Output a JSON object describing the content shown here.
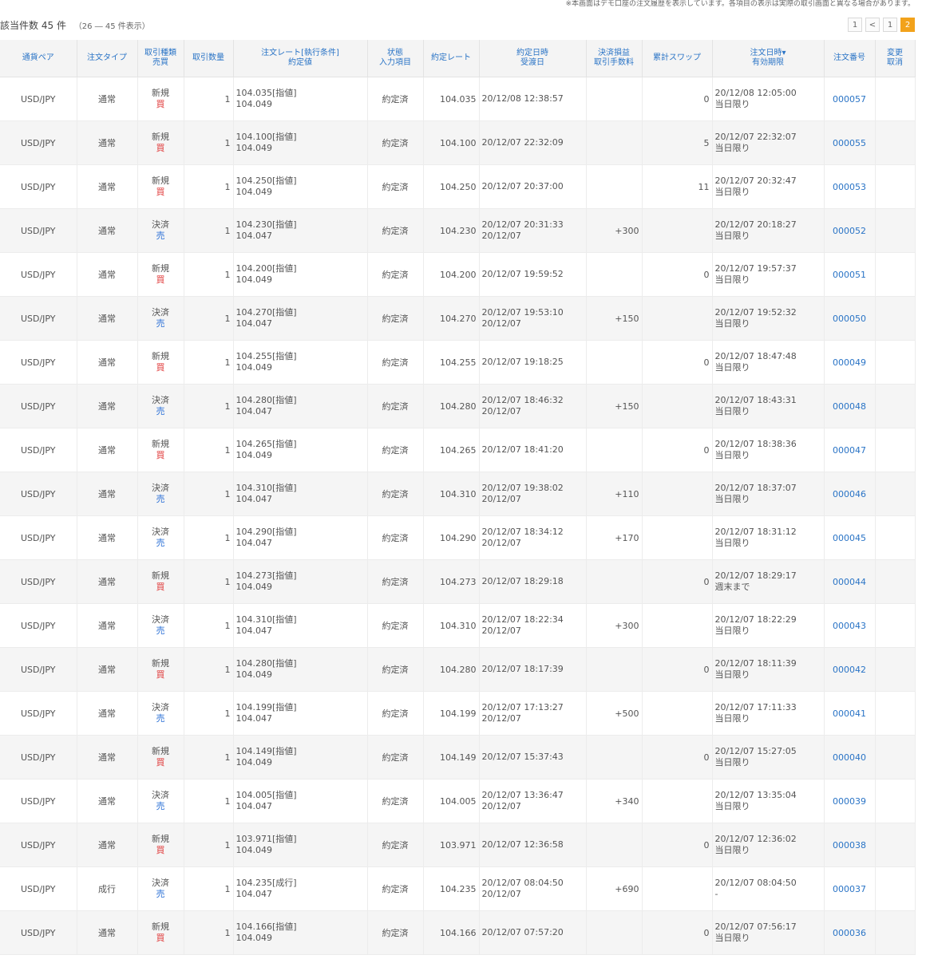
{
  "notice": "※本画面はデモ口座の注文履歴を表示しています。各項目の表示は実際の取引画面と異なる場合があります。",
  "summary": {
    "label": "該当件数",
    "count": "45",
    "unit": "件",
    "range": "（26 ― 45 件表示）"
  },
  "pager": [
    "1",
    "<",
    "1",
    "2"
  ],
  "columns": [
    {
      "l1": "通貨ペア",
      "l2": ""
    },
    {
      "l1": "注文タイプ",
      "l2": ""
    },
    {
      "l1": "取引種類",
      "l2": "売買"
    },
    {
      "l1": "取引数量",
      "l2": ""
    },
    {
      "l1": "注文レート[執行条件]",
      "l2": "約定値"
    },
    {
      "l1": "状態",
      "l2": "入力項目"
    },
    {
      "l1": "約定レート",
      "l2": ""
    },
    {
      "l1": "約定日時",
      "l2": "受渡日"
    },
    {
      "l1": "決済損益",
      "l2": "取引手数料"
    },
    {
      "l1": "累計スワップ",
      "l2": ""
    },
    {
      "l1": "注文日時▾",
      "l2": "有効期限"
    },
    {
      "l1": "注文番号",
      "l2": ""
    },
    {
      "l1": "変更",
      "l2": "取消"
    }
  ],
  "rows": [
    {
      "pair": "USD/JPY",
      "type": "通常",
      "kind": "新規",
      "side": "買",
      "side_class": "buy",
      "qty": "1",
      "rate": "104.035[指値]",
      "rate2": "104.049",
      "status": "約定済",
      "exec": "104.035",
      "exec_dt": "20/12/08 12:38:57",
      "exec_dt2": "",
      "pl": "",
      "swap": "0",
      "order_dt": "20/12/08 12:05:00",
      "expiry": "当日限り",
      "order_no": "000057"
    },
    {
      "pair": "USD/JPY",
      "type": "通常",
      "kind": "新規",
      "side": "買",
      "side_class": "buy",
      "qty": "1",
      "rate": "104.100[指値]",
      "rate2": "104.049",
      "status": "約定済",
      "exec": "104.100",
      "exec_dt": "20/12/07 22:32:09",
      "exec_dt2": "",
      "pl": "",
      "swap": "5",
      "order_dt": "20/12/07 22:32:07",
      "expiry": "当日限り",
      "order_no": "000055"
    },
    {
      "pair": "USD/JPY",
      "type": "通常",
      "kind": "新規",
      "side": "買",
      "side_class": "buy",
      "qty": "1",
      "rate": "104.250[指値]",
      "rate2": "104.049",
      "status": "約定済",
      "exec": "104.250",
      "exec_dt": "20/12/07 20:37:00",
      "exec_dt2": "",
      "pl": "",
      "swap": "11",
      "order_dt": "20/12/07 20:32:47",
      "expiry": "当日限り",
      "order_no": "000053"
    },
    {
      "pair": "USD/JPY",
      "type": "通常",
      "kind": "決済",
      "side": "売",
      "side_class": "sell",
      "qty": "1",
      "rate": "104.230[指値]",
      "rate2": "104.047",
      "status": "約定済",
      "exec": "104.230",
      "exec_dt": "20/12/07 20:31:33",
      "exec_dt2": "20/12/07",
      "pl": "+300",
      "swap": "",
      "order_dt": "20/12/07 20:18:27",
      "expiry": "当日限り",
      "order_no": "000052"
    },
    {
      "pair": "USD/JPY",
      "type": "通常",
      "kind": "新規",
      "side": "買",
      "side_class": "buy",
      "qty": "1",
      "rate": "104.200[指値]",
      "rate2": "104.049",
      "status": "約定済",
      "exec": "104.200",
      "exec_dt": "20/12/07 19:59:52",
      "exec_dt2": "",
      "pl": "",
      "swap": "0",
      "order_dt": "20/12/07 19:57:37",
      "expiry": "当日限り",
      "order_no": "000051"
    },
    {
      "pair": "USD/JPY",
      "type": "通常",
      "kind": "決済",
      "side": "売",
      "side_class": "sell",
      "qty": "1",
      "rate": "104.270[指値]",
      "rate2": "104.047",
      "status": "約定済",
      "exec": "104.270",
      "exec_dt": "20/12/07 19:53:10",
      "exec_dt2": "20/12/07",
      "pl": "+150",
      "swap": "",
      "order_dt": "20/12/07 19:52:32",
      "expiry": "当日限り",
      "order_no": "000050"
    },
    {
      "pair": "USD/JPY",
      "type": "通常",
      "kind": "新規",
      "side": "買",
      "side_class": "buy",
      "qty": "1",
      "rate": "104.255[指値]",
      "rate2": "104.049",
      "status": "約定済",
      "exec": "104.255",
      "exec_dt": "20/12/07 19:18:25",
      "exec_dt2": "",
      "pl": "",
      "swap": "0",
      "order_dt": "20/12/07 18:47:48",
      "expiry": "当日限り",
      "order_no": "000049"
    },
    {
      "pair": "USD/JPY",
      "type": "通常",
      "kind": "決済",
      "side": "売",
      "side_class": "sell",
      "qty": "1",
      "rate": "104.280[指値]",
      "rate2": "104.047",
      "status": "約定済",
      "exec": "104.280",
      "exec_dt": "20/12/07 18:46:32",
      "exec_dt2": "20/12/07",
      "pl": "+150",
      "swap": "",
      "order_dt": "20/12/07 18:43:31",
      "expiry": "当日限り",
      "order_no": "000048"
    },
    {
      "pair": "USD/JPY",
      "type": "通常",
      "kind": "新規",
      "side": "買",
      "side_class": "buy",
      "qty": "1",
      "rate": "104.265[指値]",
      "rate2": "104.049",
      "status": "約定済",
      "exec": "104.265",
      "exec_dt": "20/12/07 18:41:20",
      "exec_dt2": "",
      "pl": "",
      "swap": "0",
      "order_dt": "20/12/07 18:38:36",
      "expiry": "当日限り",
      "order_no": "000047"
    },
    {
      "pair": "USD/JPY",
      "type": "通常",
      "kind": "決済",
      "side": "売",
      "side_class": "sell",
      "qty": "1",
      "rate": "104.310[指値]",
      "rate2": "104.047",
      "status": "約定済",
      "exec": "104.310",
      "exec_dt": "20/12/07 19:38:02",
      "exec_dt2": "20/12/07",
      "pl": "+110",
      "swap": "",
      "order_dt": "20/12/07 18:37:07",
      "expiry": "当日限り",
      "order_no": "000046"
    },
    {
      "pair": "USD/JPY",
      "type": "通常",
      "kind": "決済",
      "side": "売",
      "side_class": "sell",
      "qty": "1",
      "rate": "104.290[指値]",
      "rate2": "104.047",
      "status": "約定済",
      "exec": "104.290",
      "exec_dt": "20/12/07 18:34:12",
      "exec_dt2": "20/12/07",
      "pl": "+170",
      "swap": "",
      "order_dt": "20/12/07 18:31:12",
      "expiry": "当日限り",
      "order_no": "000045"
    },
    {
      "pair": "USD/JPY",
      "type": "通常",
      "kind": "新規",
      "side": "買",
      "side_class": "buy",
      "qty": "1",
      "rate": "104.273[指値]",
      "rate2": "104.049",
      "status": "約定済",
      "exec": "104.273",
      "exec_dt": "20/12/07 18:29:18",
      "exec_dt2": "",
      "pl": "",
      "swap": "0",
      "order_dt": "20/12/07 18:29:17",
      "expiry": "週末まで",
      "order_no": "000044"
    },
    {
      "pair": "USD/JPY",
      "type": "通常",
      "kind": "決済",
      "side": "売",
      "side_class": "sell",
      "qty": "1",
      "rate": "104.310[指値]",
      "rate2": "104.047",
      "status": "約定済",
      "exec": "104.310",
      "exec_dt": "20/12/07 18:22:34",
      "exec_dt2": "20/12/07",
      "pl": "+300",
      "swap": "",
      "order_dt": "20/12/07 18:22:29",
      "expiry": "当日限り",
      "order_no": "000043"
    },
    {
      "pair": "USD/JPY",
      "type": "通常",
      "kind": "新規",
      "side": "買",
      "side_class": "buy",
      "qty": "1",
      "rate": "104.280[指値]",
      "rate2": "104.049",
      "status": "約定済",
      "exec": "104.280",
      "exec_dt": "20/12/07 18:17:39",
      "exec_dt2": "",
      "pl": "",
      "swap": "0",
      "order_dt": "20/12/07 18:11:39",
      "expiry": "当日限り",
      "order_no": "000042"
    },
    {
      "pair": "USD/JPY",
      "type": "通常",
      "kind": "決済",
      "side": "売",
      "side_class": "sell",
      "qty": "1",
      "rate": "104.199[指値]",
      "rate2": "104.047",
      "status": "約定済",
      "exec": "104.199",
      "exec_dt": "20/12/07 17:13:27",
      "exec_dt2": "20/12/07",
      "pl": "+500",
      "swap": "",
      "order_dt": "20/12/07 17:11:33",
      "expiry": "当日限り",
      "order_no": "000041"
    },
    {
      "pair": "USD/JPY",
      "type": "通常",
      "kind": "新規",
      "side": "買",
      "side_class": "buy",
      "qty": "1",
      "rate": "104.149[指値]",
      "rate2": "104.049",
      "status": "約定済",
      "exec": "104.149",
      "exec_dt": "20/12/07 15:37:43",
      "exec_dt2": "",
      "pl": "",
      "swap": "0",
      "order_dt": "20/12/07 15:27:05",
      "expiry": "当日限り",
      "order_no": "000040"
    },
    {
      "pair": "USD/JPY",
      "type": "通常",
      "kind": "決済",
      "side": "売",
      "side_class": "sell",
      "qty": "1",
      "rate": "104.005[指値]",
      "rate2": "104.047",
      "status": "約定済",
      "exec": "104.005",
      "exec_dt": "20/12/07 13:36:47",
      "exec_dt2": "20/12/07",
      "pl": "+340",
      "swap": "",
      "order_dt": "20/12/07 13:35:04",
      "expiry": "当日限り",
      "order_no": "000039"
    },
    {
      "pair": "USD/JPY",
      "type": "通常",
      "kind": "新規",
      "side": "買",
      "side_class": "buy",
      "qty": "1",
      "rate": "103.971[指値]",
      "rate2": "104.049",
      "status": "約定済",
      "exec": "103.971",
      "exec_dt": "20/12/07 12:36:58",
      "exec_dt2": "",
      "pl": "",
      "swap": "0",
      "order_dt": "20/12/07 12:36:02",
      "expiry": "当日限り",
      "order_no": "000038"
    },
    {
      "pair": "USD/JPY",
      "type": "成行",
      "kind": "決済",
      "side": "売",
      "side_class": "sell",
      "qty": "1",
      "rate": "104.235[成行]",
      "rate2": "104.047",
      "status": "約定済",
      "exec": "104.235",
      "exec_dt": "20/12/07 08:04:50",
      "exec_dt2": "20/12/07",
      "pl": "+690",
      "swap": "",
      "order_dt": "20/12/07 08:04:50",
      "expiry": "-",
      "order_no": "000037"
    },
    {
      "pair": "USD/JPY",
      "type": "通常",
      "kind": "新規",
      "side": "買",
      "side_class": "buy",
      "qty": "1",
      "rate": "104.166[指値]",
      "rate2": "104.049",
      "status": "約定済",
      "exec": "104.166",
      "exec_dt": "20/12/07 07:57:20",
      "exec_dt2": "",
      "pl": "",
      "swap": "0",
      "order_dt": "20/12/07 07:56:17",
      "expiry": "当日限り",
      "order_no": "000036"
    }
  ]
}
